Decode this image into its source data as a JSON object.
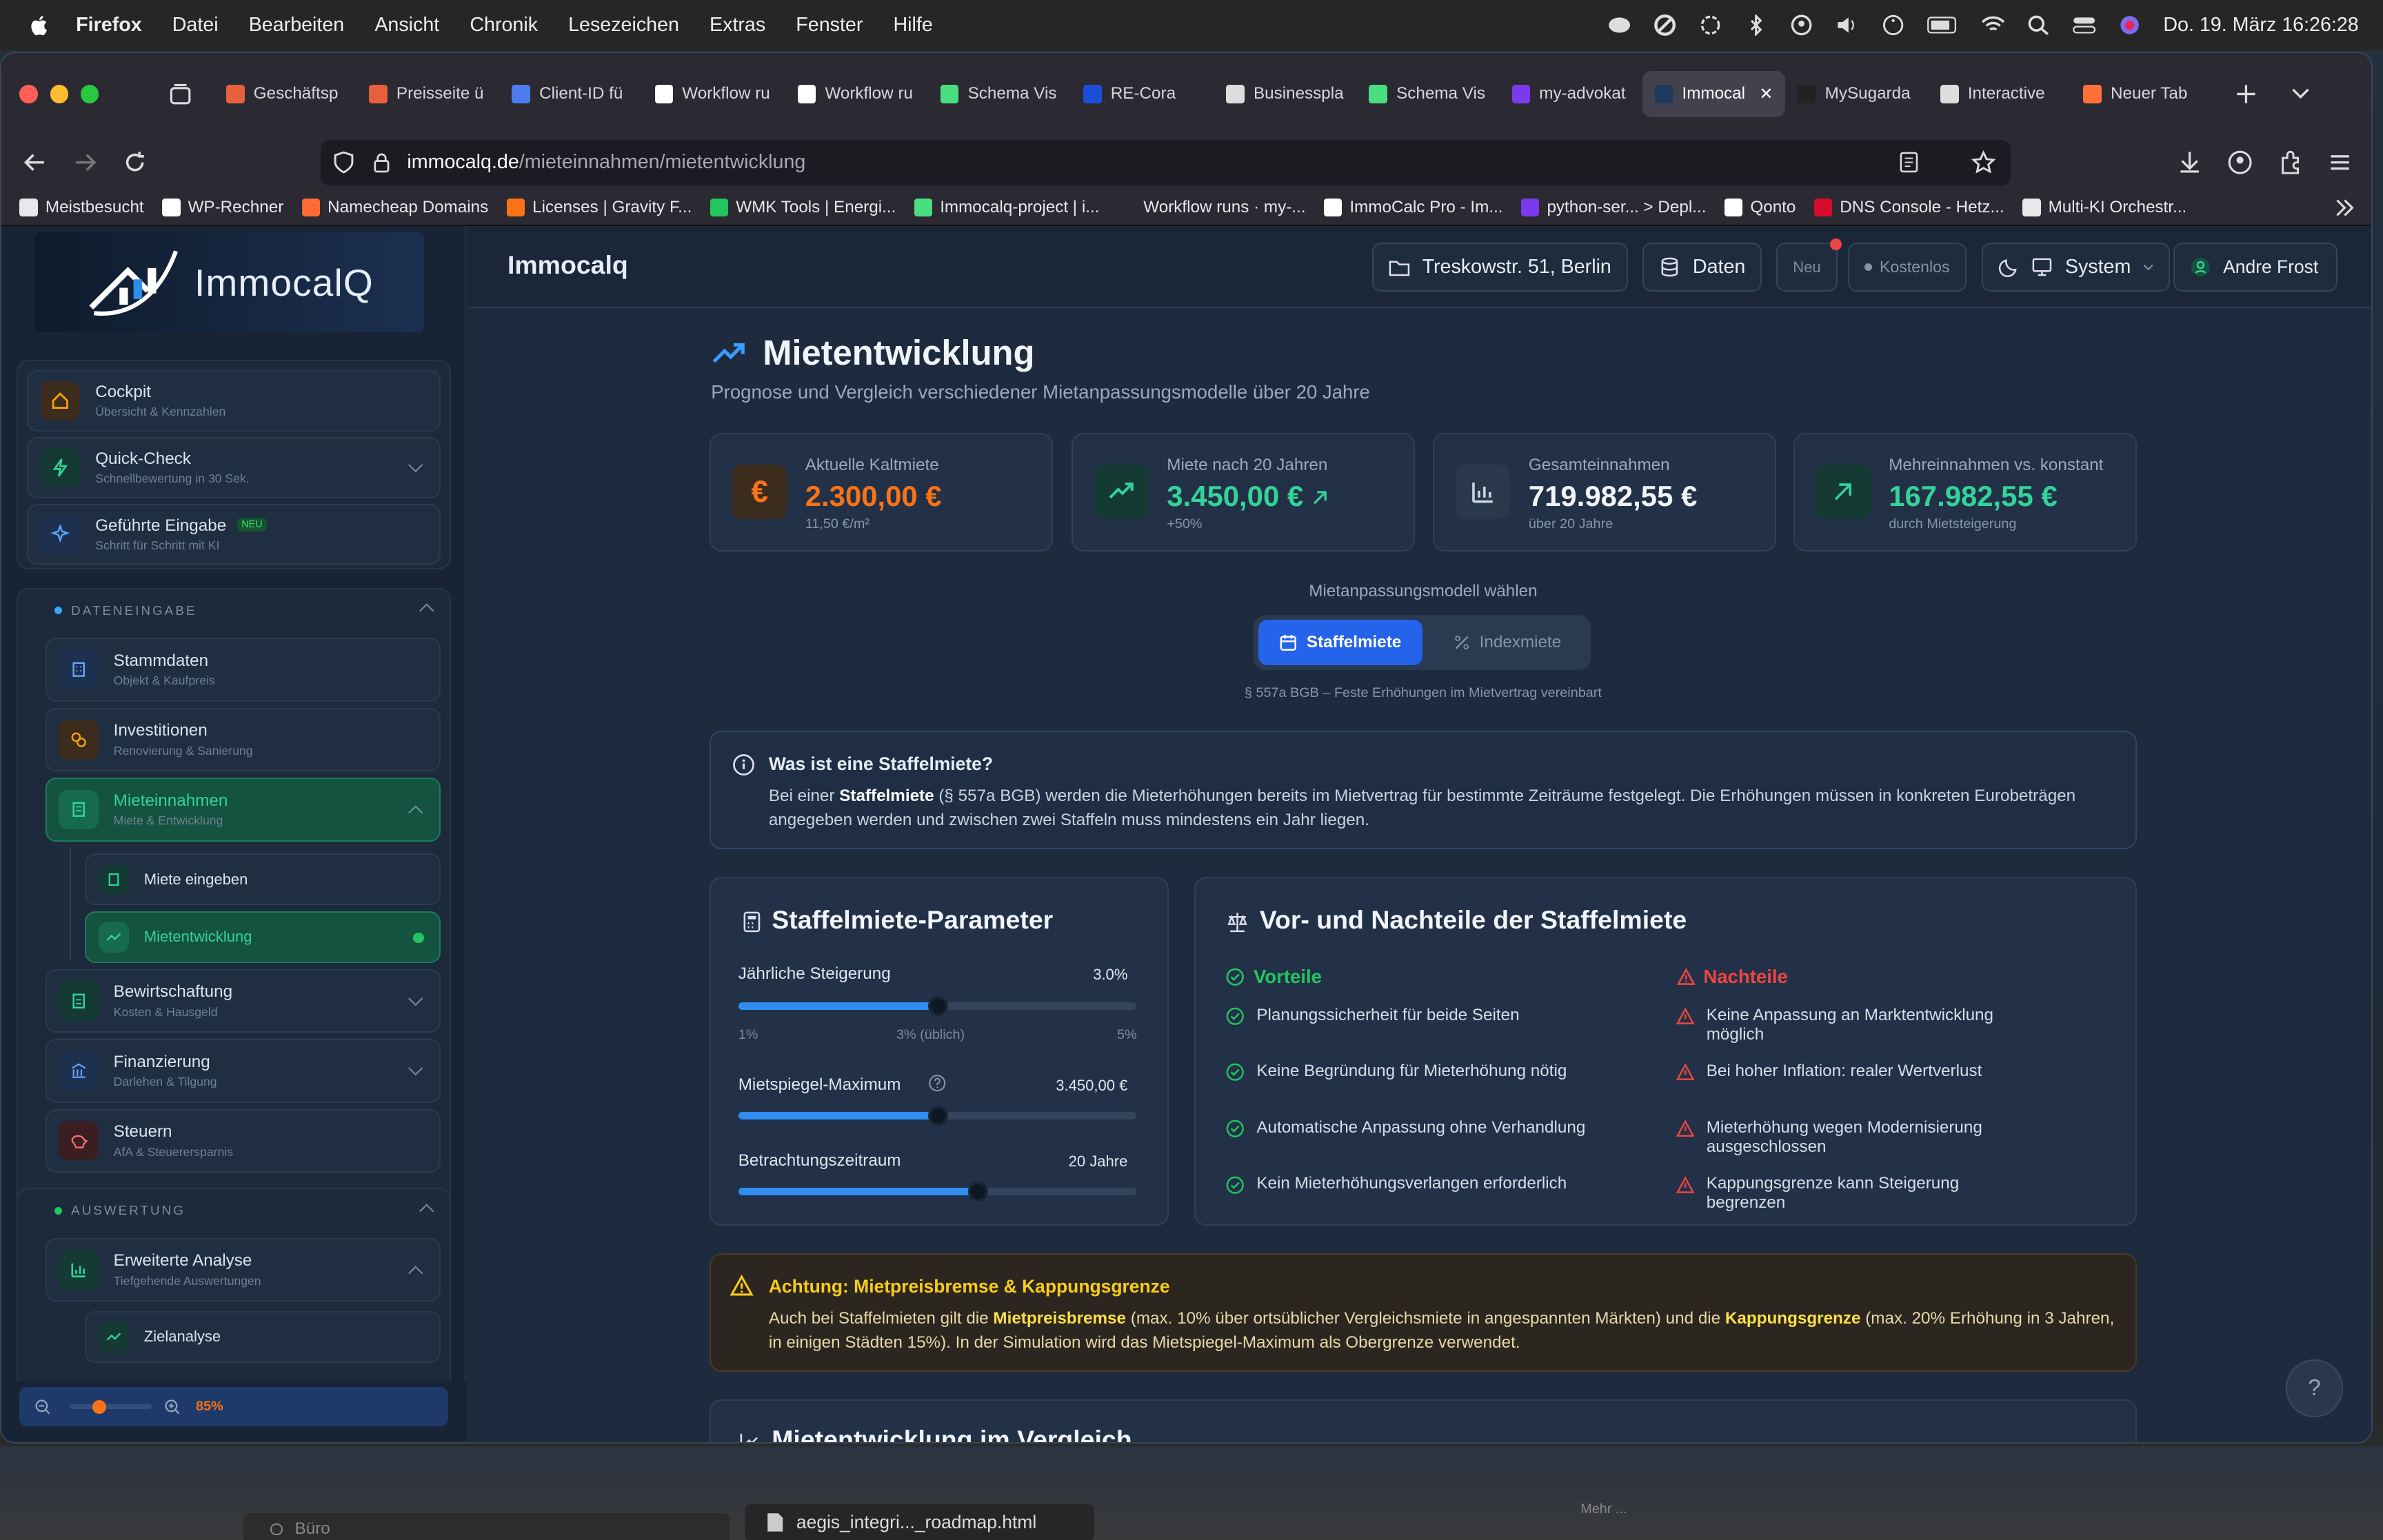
{
  "menubar": {
    "app": "Firefox",
    "items": [
      "Datei",
      "Bearbeiten",
      "Ansicht",
      "Chronik",
      "Lesezeichen",
      "Extras",
      "Fenster",
      "Hilfe"
    ],
    "datetime": "Do. 19. März 16:26:28"
  },
  "tabs": [
    {
      "label": "Geschäftsp",
      "color": "#e5603b"
    },
    {
      "label": "Preisseite ü",
      "color": "#e5603b"
    },
    {
      "label": "Client-ID fü",
      "color": "#4d7cf0"
    },
    {
      "label": "Workflow ru",
      "color": "#ffffff"
    },
    {
      "label": "Workflow ru",
      "color": "#ffffff"
    },
    {
      "label": "Schema Vis",
      "color": "#4ade80"
    },
    {
      "label": "RE-Cora",
      "color": "#1d4ed8"
    },
    {
      "label": "Businesspla",
      "color": "#dddddd"
    },
    {
      "label": "Schema Vis",
      "color": "#4ade80"
    },
    {
      "label": "my-advokat",
      "color": "#7c3aed"
    },
    {
      "label": "Immocal",
      "color": "#1e3a5f",
      "active": true
    },
    {
      "label": "MySugarda",
      "color": "#222222"
    },
    {
      "label": "Interactive",
      "color": "#dddddd"
    },
    {
      "label": "Neuer Tab",
      "color": "#ff7139"
    }
  ],
  "url": {
    "domain": "immocalq.de",
    "path": "/mieteinnahmen/mietentwicklung"
  },
  "bookmarks": [
    {
      "label": "Meistbesucht",
      "color": "#e8e8ea"
    },
    {
      "label": "WP-Rechner",
      "color": "#ffffff"
    },
    {
      "label": "Namecheap Domains",
      "color": "#ff6b35"
    },
    {
      "label": "Licenses | Gravity F...",
      "color": "#f97316"
    },
    {
      "label": "WMK Tools | Energi...",
      "color": "#22c55e"
    },
    {
      "label": "Immocalq-project | i...",
      "color": "#4ade80"
    },
    {
      "label": "Workflow runs · my-...",
      "color": "#2b2a33"
    },
    {
      "label": "ImmoCalc Pro - Im...",
      "color": "#ffffff"
    },
    {
      "label": "python-ser... > Depl...",
      "color": "#7c3aed"
    },
    {
      "label": "Qonto",
      "color": "#ffffff"
    },
    {
      "label": "DNS Console - Hetz...",
      "color": "#d50c2d"
    },
    {
      "label": "Multi-KI Orchestr...",
      "color": "#e8e8ea"
    }
  ],
  "sidebar": {
    "logo": "ImmocalQ",
    "top": [
      {
        "label": "Cockpit",
        "sub": "Übersicht & Kennzahlen"
      },
      {
        "label": "Quick-Check",
        "sub": "Schnellbewertung in 30 Sek."
      },
      {
        "label": "Geführte Eingabe",
        "sub": "Schritt für Schritt mit KI",
        "badge": "NEU"
      }
    ],
    "section1": "DATENEINGABE",
    "data_items": [
      {
        "label": "Stammdaten",
        "sub": "Objekt & Kaufpreis"
      },
      {
        "label": "Investitionen",
        "sub": "Renovierung & Sanierung"
      },
      {
        "label": "Mieteinnahmen",
        "sub": "Miete & Entwicklung"
      },
      {
        "label": "Miete eingeben"
      },
      {
        "label": "Mietentwicklung"
      },
      {
        "label": "Bewirtschaftung",
        "sub": "Kosten & Hausgeld"
      },
      {
        "label": "Finanzierung",
        "sub": "Darlehen & Tilgung"
      },
      {
        "label": "Steuern",
        "sub": "AfA & Steuerersparnis"
      }
    ],
    "section2": "AUSWERTUNG",
    "eval_items": [
      {
        "label": "Erweiterte Analyse",
        "sub": "Tiefgehende Auswertungen"
      },
      {
        "label": "Zielanalyse"
      }
    ],
    "zoom": "85%",
    "zoom_level": 0.85
  },
  "topbar": {
    "title": "Immocalq",
    "address": "Treskowstr. 51, Berlin",
    "data_btn": "Daten",
    "new_btn": "Neu",
    "plan": "Kostenlos",
    "theme": "System",
    "user": "Andre Frost"
  },
  "page": {
    "title": "Mietentwicklung",
    "subtitle": "Prognose und Vergleich verschiedener Mietanpassungsmodelle über 20 Jahre",
    "stats": [
      {
        "label": "Aktuelle Kaltmiete",
        "value": "2.300,00 €",
        "sub": "11,50 €/m²",
        "color": "#f97316"
      },
      {
        "label": "Miete nach 20 Jahren",
        "value": "3.450,00 €",
        "sub": "+50%",
        "color": "#34d399"
      },
      {
        "label": "Gesamteinnahmen",
        "value": "719.982,55 €",
        "sub": "über 20 Jahre",
        "color": "#f1f5f9"
      },
      {
        "label": "Mehreinnahmen vs. konstant",
        "value": "167.982,55 €",
        "sub": "durch Mietsteigerung",
        "color": "#34d399"
      }
    ],
    "model_label": "Mietanpassungsmodell wählen",
    "model_tabs": [
      "Staffelmiete",
      "Indexmiete"
    ],
    "model_note": "§ 557a BGB – Feste Erhöhungen im Mietvertrag vereinbart",
    "info": {
      "title": "Was ist eine Staffelmiete?",
      "t1": "Bei einer ",
      "t2": "Staffelmiete",
      "t3": " (§ 557a BGB) werden die Mieterhöhungen bereits im Mietvertrag für bestimmte Zeiträume festgelegt. Die Erhöhungen müssen in konkreten Eurobeträgen angegeben werden und zwischen zwei Staffeln muss mindestens ein Jahr liegen."
    },
    "params": {
      "title": "Staffelmiete-Parameter",
      "s1_label": "Jährliche Steigerung",
      "s1_value": "3.0%",
      "s1_level": 0.5,
      "s1_ticks": [
        "1%",
        "3% (üblich)",
        "5%"
      ],
      "s2_label": "Mietspiegel-Maximum",
      "s2_value": "3.450,00 €",
      "s2_level": 0.5,
      "s3_label": "Betrachtungszeitraum",
      "s3_value": "20 Jahre",
      "s3_level": 0.6
    },
    "pros_cons": {
      "title": "Vor- und Nachteile der Staffelmiete",
      "pros_title": "Vorteile",
      "pros": [
        "Planungssicherheit für beide Seiten",
        "Keine Begründung für Mieterhöhung nötig",
        "Automatische Anpassung ohne Verhandlung",
        "Kein Mieterhöhungsverlangen erforderlich"
      ],
      "cons_title": "Nachteile",
      "cons": [
        "Keine Anpassung an Marktentwicklung möglich",
        "Bei hoher Inflation: realer Wertverlust",
        "Mieterhöhung wegen Modernisierung ausgeschlossen",
        "Kappungsgrenze kann Steigerung begrenzen"
      ]
    },
    "warning": {
      "title": "Achtung: Mietpreisbremse & Kappungsgrenze",
      "t1": "Auch bei Staffelmieten gilt die ",
      "b1": "Mietpreisbremse",
      "t2": " (max. 10% über ortsüblicher Vergleichsmiete in angespannten Märkten) und die ",
      "b2": "Kappungsgrenze",
      "t3": " (max. 20% Erhöhung in 3 Jahren, in einigen Städten 15%). In der Simulation wird das Mietspiegel-Maximum als Obergrenze verwendet."
    },
    "next_section": "Mietentwicklung im Vergleich",
    "help": "?"
  },
  "taskbar": {
    "item1": "Büro",
    "file": "aegis_integri..._roadmap.html",
    "item3": "Mehr ..."
  }
}
